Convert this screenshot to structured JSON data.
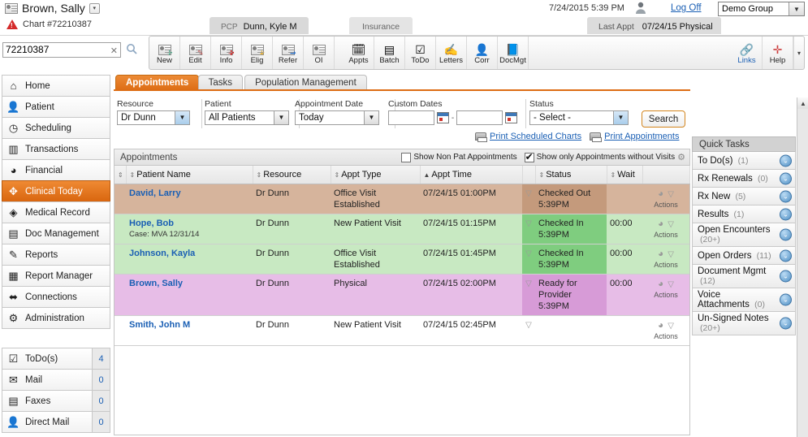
{
  "header": {
    "patient_name": "Brown, Sally",
    "patient_caret": "▾",
    "chart_label": "Chart #72210387",
    "alert_icon": "alert-triangle-icon",
    "pcp_label": "PCP",
    "pcp_value": "Dunn, Kyle M",
    "insurance_tab": "Insurance",
    "last_appt_label": "Last Appt",
    "last_appt_value": "07/24/15 Physical",
    "datetime": "7/24/2015 5:39 PM",
    "user_icon": "user-avatar-icon",
    "log_off": "Log Off",
    "group_value": "Demo Group",
    "group_caret": "▼"
  },
  "search": {
    "value": "72210387",
    "clear": "✕",
    "magnifier_icon": "search-icon"
  },
  "toolbar": {
    "left_items": [
      {
        "label": "New",
        "icon": "new-patient-icon",
        "badge": "✛"
      },
      {
        "label": "Edit",
        "icon": "edit-patient-icon",
        "badge": "✎"
      },
      {
        "label": "Info",
        "icon": "patient-info-icon",
        "badge": "✚"
      },
      {
        "label": "Elig",
        "icon": "eligibility-icon",
        "badge": "★"
      },
      {
        "label": "Refer",
        "icon": "referral-icon",
        "badge": "➡"
      },
      {
        "label": "OI",
        "icon": "other-info-icon",
        "badge": ""
      }
    ],
    "mid_items": [
      {
        "label": "Appts",
        "icon": "appointments-icon",
        "glyph": "🗓"
      },
      {
        "label": "Batch",
        "icon": "batch-icon",
        "glyph": "▤"
      },
      {
        "label": "ToDo",
        "icon": "todo-icon",
        "glyph": "☑"
      },
      {
        "label": "Letters",
        "icon": "letters-icon",
        "glyph": "✍"
      },
      {
        "label": "Corr",
        "icon": "correspondence-icon",
        "glyph": "👤"
      },
      {
        "label": "DocMgt",
        "icon": "document-mgmt-icon",
        "glyph": "📘"
      }
    ],
    "right_items": [
      {
        "label": "Links",
        "icon": "links-icon",
        "glyph": "🔗",
        "link": true
      },
      {
        "label": "Help",
        "icon": "help-icon",
        "glyph": "✛",
        "link": false
      }
    ],
    "overflow_caret": "▾"
  },
  "sidebar": {
    "items": [
      {
        "label": "Home",
        "icon": "home-icon",
        "glyph": "⌂",
        "active": false
      },
      {
        "label": "Patient",
        "icon": "patient-icon",
        "glyph": "👤",
        "active": false
      },
      {
        "label": "Scheduling",
        "icon": "scheduling-icon",
        "glyph": "◷",
        "active": false
      },
      {
        "label": "Transactions",
        "icon": "transactions-icon",
        "glyph": "▥",
        "active": false
      },
      {
        "label": "Financial",
        "icon": "financial-icon",
        "glyph": "◕",
        "active": false
      },
      {
        "label": "Clinical Today",
        "icon": "clinical-today-icon",
        "glyph": "✥",
        "active": true
      },
      {
        "label": "Medical Record",
        "icon": "medical-record-icon",
        "glyph": "◈",
        "active": false
      },
      {
        "label": "Doc Management",
        "icon": "doc-management-icon",
        "glyph": "▤",
        "active": false
      },
      {
        "label": "Reports",
        "icon": "reports-icon",
        "glyph": "✎",
        "active": false
      },
      {
        "label": "Report Manager",
        "icon": "report-manager-icon",
        "glyph": "▦",
        "active": false
      },
      {
        "label": "Connections",
        "icon": "connections-icon",
        "glyph": "⬌",
        "active": false
      },
      {
        "label": "Administration",
        "icon": "administration-icon",
        "glyph": "⚙",
        "active": false
      }
    ],
    "inbox": [
      {
        "label": "ToDo(s)",
        "icon": "todo-icon",
        "glyph": "☑",
        "count": "4"
      },
      {
        "label": "Mail",
        "icon": "mail-icon",
        "glyph": "✉",
        "count": "0"
      },
      {
        "label": "Faxes",
        "icon": "fax-icon",
        "glyph": "▤",
        "count": "0"
      },
      {
        "label": "Direct Mail",
        "icon": "direct-mail-icon",
        "glyph": "👤",
        "count": "0"
      }
    ]
  },
  "tabs": [
    {
      "label": "Appointments",
      "active": true
    },
    {
      "label": "Tasks",
      "active": false
    },
    {
      "label": "Population Management",
      "active": false
    }
  ],
  "filters": {
    "resource_label": "Resource",
    "resource_value": "Dr Dunn",
    "patient_label": "Patient",
    "patient_value": "All Patients",
    "appt_date_label": "Appointment Date",
    "appt_date_value": "Today",
    "custom_dates_label": "Custom Dates",
    "custom_date_from": "",
    "custom_date_to": "",
    "calendar_icon": "calendar-icon",
    "status_label": "Status",
    "status_value": "- Select -",
    "search_button": "Search",
    "caret": "▼"
  },
  "print_links": [
    {
      "label": "Print Scheduled Charts",
      "icon": "printer-icon"
    },
    {
      "label": "Print Appointments",
      "icon": "printer-icon"
    }
  ],
  "appointments_panel": {
    "title": "Appointments",
    "show_non_pat": {
      "label": "Show Non Pat Appointments",
      "checked": false
    },
    "show_without_visits": {
      "label": "Show only Appointments without Visits",
      "checked": true
    },
    "gear_icon": "settings-gear-icon",
    "columns": [
      "Patient Name",
      "Resource",
      "Appt Type",
      "Appt Time",
      "Status",
      "Wait"
    ],
    "sort_column": "Appt Time",
    "rows": [
      {
        "patient": "David, Larry",
        "case": "",
        "resource": "Dr Dunn",
        "appt_type": "Office Visit Established",
        "appt_time": "07/24/15 01:00PM",
        "status": "Checked Out 5:39PM",
        "wait": "",
        "actions_label": "Actions",
        "row_class": "row-out"
      },
      {
        "patient": "Hope, Bob",
        "case": "Case: MVA 12/31/14",
        "resource": "Dr Dunn",
        "appt_type": "New Patient Visit",
        "appt_time": "07/24/15 01:15PM",
        "status": "Checked In 5:39PM",
        "wait": "00:00",
        "actions_label": "Actions",
        "row_class": "row-in"
      },
      {
        "patient": "Johnson, Kayla",
        "case": "",
        "resource": "Dr Dunn",
        "appt_type": "Office Visit Established",
        "appt_time": "07/24/15 01:45PM",
        "status": "Checked In 5:39PM",
        "wait": "00:00",
        "actions_label": "Actions",
        "row_class": "row-in"
      },
      {
        "patient": "Brown, Sally",
        "case": "",
        "resource": "Dr Dunn",
        "appt_type": "Physical",
        "appt_time": "07/24/15 02:00PM",
        "status": "Ready for Provider 5:39PM",
        "wait": "00:00",
        "actions_label": "Actions",
        "row_class": "row-ready"
      },
      {
        "patient": "Smith, John M",
        "case": "",
        "resource": "Dr Dunn",
        "appt_type": "New Patient Visit",
        "appt_time": "07/24/15 02:45PM",
        "status": "",
        "wait": "",
        "actions_label": "Actions",
        "row_class": "row-none"
      }
    ]
  },
  "quick_tasks": {
    "title": "Quick Tasks",
    "items": [
      {
        "label": "To Do(s)",
        "count": "(1)"
      },
      {
        "label": "Rx Renewals",
        "count": "(0)"
      },
      {
        "label": "Rx New",
        "count": "(5)"
      },
      {
        "label": "Results",
        "count": "(1)"
      },
      {
        "label": "Open Encounters",
        "count": "(20+)"
      },
      {
        "label": "Open Orders",
        "count": "(11)"
      },
      {
        "label": "Document Mgmt",
        "count": "(12)"
      },
      {
        "label": "Voice Attachments",
        "count": "(0)"
      },
      {
        "label": "Un-Signed Notes",
        "count": "(20+)"
      }
    ],
    "expand_glyph": "⌄"
  },
  "scrollbar": {
    "up_arrow": "▲"
  },
  "colors": {
    "accent_orange": "#dd6d15",
    "link_blue": "#1a5fb4",
    "status_checked_out": "#d6b49c",
    "status_checked_in": "#c8e9c2",
    "status_ready": "#e7bde7"
  }
}
